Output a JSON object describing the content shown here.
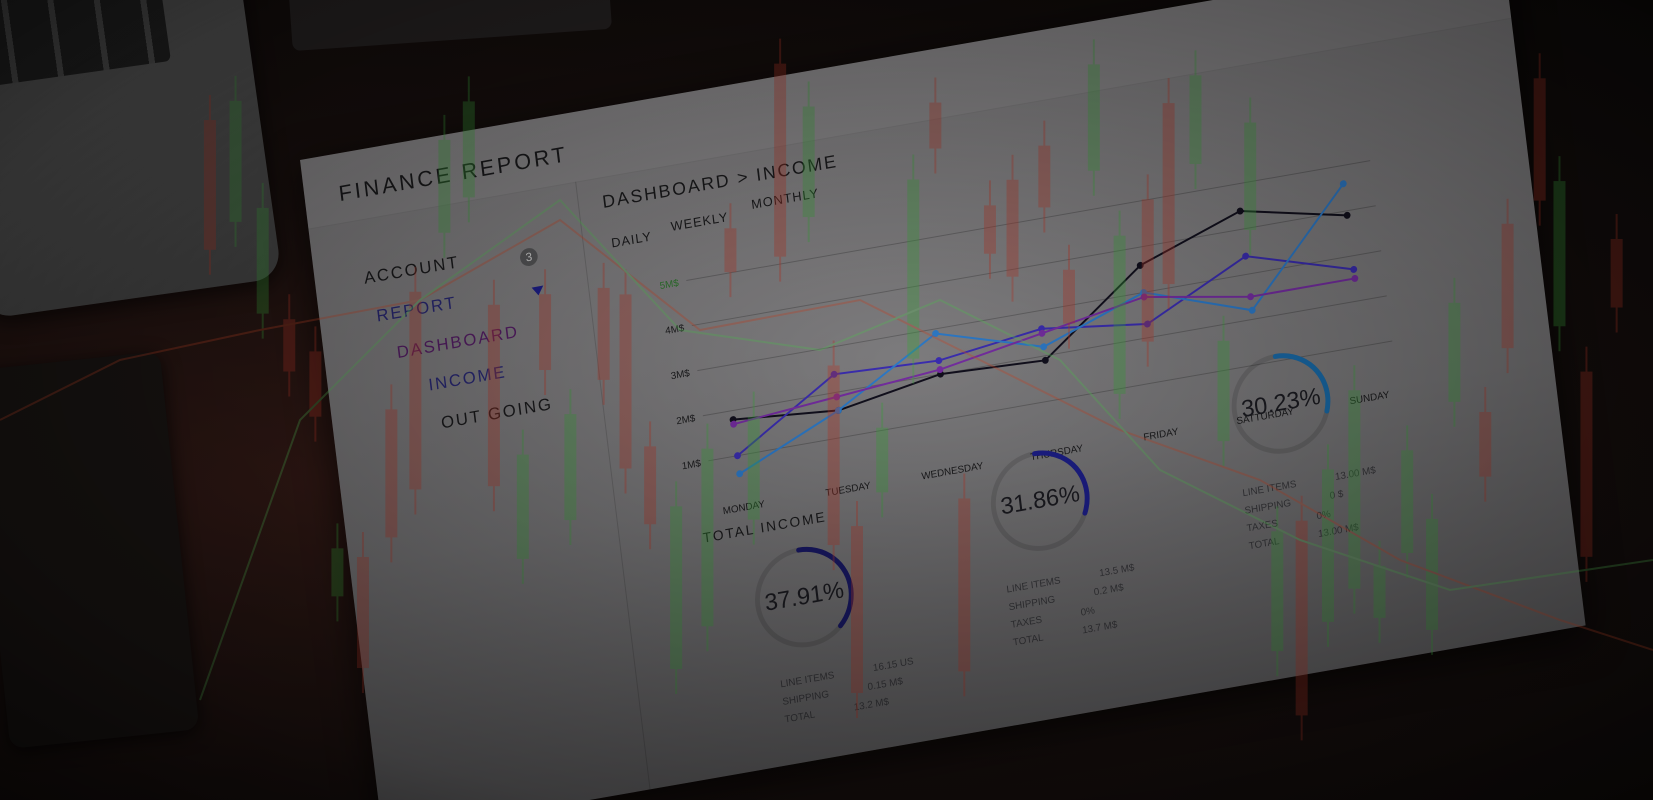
{
  "report": {
    "title": "FINANCE REPORT",
    "breadcrumb": "DASHBOARD > INCOME",
    "nav": [
      "ACCOUNT",
      "REPORT",
      "DASHBOARD",
      "INCOME",
      "OUT GOING"
    ],
    "report_badge": "3",
    "ranges": [
      "DAILY",
      "WEEKLY",
      "MONTHLY"
    ]
  },
  "chart_data": {
    "type": "line",
    "categories": [
      "MONDAY",
      "TUESDAY",
      "WEDNESDAY",
      "THURSDAY",
      "FRIDAY",
      "SATTURDAY",
      "SUNDAY"
    ],
    "y_ticks": [
      "1M$",
      "2M$",
      "3M$",
      "4M$",
      "5M$"
    ],
    "ylim": [
      0.5,
      5.5
    ],
    "series": [
      {
        "color": "#12101e",
        "values": [
          1.8,
          1.6,
          2.0,
          1.9,
          3.6,
          4.4,
          3.9
        ]
      },
      {
        "color": "#3d2fb8",
        "values": [
          1.0,
          2.4,
          2.3,
          2.6,
          2.3,
          3.4,
          2.7
        ]
      },
      {
        "color": "#2f7fd0",
        "values": [
          0.6,
          1.6,
          2.9,
          2.2,
          3.0,
          2.2,
          4.6
        ]
      },
      {
        "color": "#7a2fa8",
        "values": [
          1.7,
          1.9,
          2.1,
          2.5,
          2.9,
          2.5,
          2.5
        ]
      }
    ],
    "colors": {
      "accent": "#1e2090"
    }
  },
  "totals": {
    "label": "TOTAL INCOME",
    "rings": [
      {
        "value": "37.91%",
        "percent": 37.91,
        "color": "#1a1a6a"
      },
      {
        "value": "31.86%",
        "percent": 31.86,
        "color": "#1e2090"
      },
      {
        "value": "30.23%",
        "percent": 30.23,
        "color": "#1a6fb0"
      }
    ],
    "stats": [
      {
        "rows": [
          [
            "LINE ITEMS",
            "16.15 US"
          ],
          [
            "SHIPPING",
            "0.15 M$"
          ],
          [
            "TOTAL",
            "13.2 M$"
          ]
        ]
      },
      {
        "rows": [
          [
            "LINE ITEMS",
            "13.5 M$"
          ],
          [
            "SHIPPING",
            "0.2 M$"
          ],
          [
            "TAXES",
            "0%"
          ],
          [
            "TOTAL",
            "13.7 M$"
          ]
        ]
      },
      {
        "rows": [
          [
            "LINE ITEMS",
            "13.00 M$"
          ],
          [
            "SHIPPING",
            "0 $"
          ],
          [
            "TAXES",
            "0%"
          ],
          [
            "TOTAL",
            "13.00 M$"
          ]
        ]
      }
    ]
  }
}
